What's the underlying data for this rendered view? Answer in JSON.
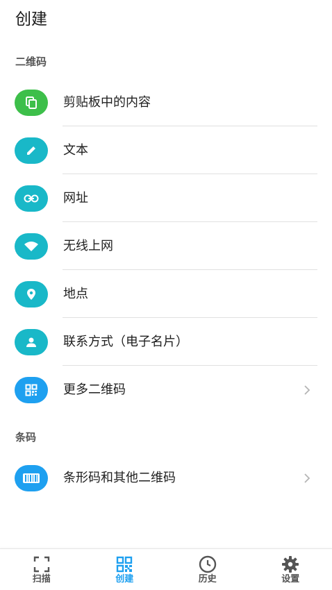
{
  "header": {
    "title": "创建"
  },
  "sections": {
    "qr": {
      "title": "二维码"
    },
    "barcode": {
      "title": "条码"
    }
  },
  "items": [
    {
      "label": "剪贴板中的内容",
      "icon": "clipboard-copy-icon",
      "color": "#3dbf4a"
    },
    {
      "label": "文本",
      "icon": "pencil-icon",
      "color": "#19b8c8"
    },
    {
      "label": "网址",
      "icon": "link-icon",
      "color": "#19b8c8"
    },
    {
      "label": "无线上网",
      "icon": "wifi-icon",
      "color": "#19b8c8"
    },
    {
      "label": "地点",
      "icon": "location-pin-icon",
      "color": "#19b8c8"
    },
    {
      "label": "联系方式（电子名片）",
      "icon": "person-icon",
      "color": "#19b8c8"
    },
    {
      "label": "更多二维码",
      "icon": "qr-code-icon",
      "color": "#1ea0f0"
    }
  ],
  "barcode_item": {
    "label": "条形码和其他二维码",
    "icon": "barcode-icon",
    "color": "#1ea0f0"
  },
  "bottom_nav": {
    "active": "create",
    "accent": "#1ea0f0",
    "items": [
      {
        "label": "扫描",
        "icon": "scan-icon"
      },
      {
        "label": "创建",
        "icon": "qr-code-icon"
      },
      {
        "label": "历史",
        "icon": "clock-icon"
      },
      {
        "label": "设置",
        "icon": "gear-icon"
      }
    ]
  }
}
